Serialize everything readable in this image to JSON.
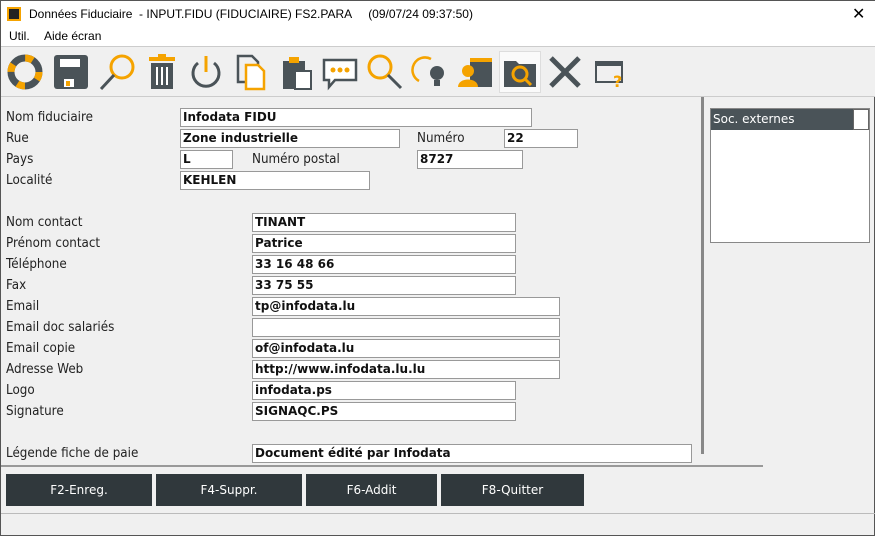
{
  "window": {
    "title": "Données Fiduciaire  - INPUT.FIDU (FIDUCIAIRE) FS2.PARA     (09/07/24 09:37:50)",
    "close": "✕"
  },
  "menu": [
    "Util.",
    "Aide écran"
  ],
  "toolbar": [
    "lifebuoy-icon",
    "save-icon",
    "search-icon",
    "trash-icon",
    "power-icon",
    "copy-icon",
    "paste-icon",
    "chat-icon",
    "zoom-icon",
    "refresh-idea-icon",
    "user-calendar-icon",
    "folder-search-icon",
    "tools-icon",
    "window-help-icon"
  ],
  "accent": "#f5a300",
  "dark": "#4a5358",
  "form": {
    "nom_fiduciaire": {
      "label": "Nom fiduciaire",
      "value": "Infodata FIDU"
    },
    "rue": {
      "label": "Rue",
      "value": "Zone industrielle"
    },
    "numero": {
      "label": "Numéro",
      "value": "22"
    },
    "pays": {
      "label": "Pays",
      "value": "L"
    },
    "numero_postal": {
      "label": "Numéro postal",
      "value": "8727"
    },
    "localite": {
      "label": "Localité",
      "value": "KEHLEN"
    },
    "contacts": [
      {
        "label": "Nom contact",
        "value": "TINANT"
      },
      {
        "label": "Prénom contact",
        "value": "Patrice"
      },
      {
        "label": "Téléphone",
        "value": "33 16 48 66"
      },
      {
        "label": "Fax",
        "value": "33 75 55"
      },
      {
        "label": "Email",
        "value": "tp@infodata.lu"
      },
      {
        "label": "Email doc salariés",
        "value": ""
      },
      {
        "label": "Email copie",
        "value": "of@infodata.lu"
      },
      {
        "label": "Adresse Web",
        "value": "http://www.infodata.lu.lu"
      },
      {
        "label": "Logo",
        "value": "infodata.ps"
      },
      {
        "label": "Signature",
        "value": "SIGNAQC.PS"
      }
    ],
    "legende": {
      "label": "Légende fiche de paie",
      "value": "Document édité par Infodata"
    }
  },
  "side_panel": {
    "header": "Soc. externes"
  },
  "buttons": [
    "F2-Enreg.",
    "F4-Suppr.",
    "F6-Addit",
    "F8-Quitter"
  ]
}
